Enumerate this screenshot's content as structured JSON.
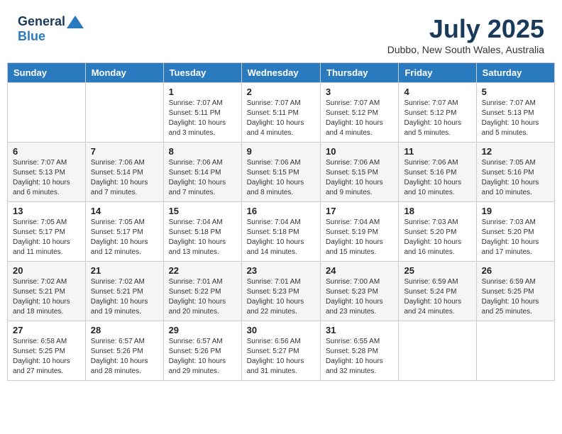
{
  "header": {
    "logo_general": "General",
    "logo_blue": "Blue",
    "month_title": "July 2025",
    "location": "Dubbo, New South Wales, Australia"
  },
  "days_of_week": [
    "Sunday",
    "Monday",
    "Tuesday",
    "Wednesday",
    "Thursday",
    "Friday",
    "Saturday"
  ],
  "weeks": [
    [
      {
        "day": "",
        "info": ""
      },
      {
        "day": "",
        "info": ""
      },
      {
        "day": "1",
        "info": "Sunrise: 7:07 AM\nSunset: 5:11 PM\nDaylight: 10 hours and 3 minutes."
      },
      {
        "day": "2",
        "info": "Sunrise: 7:07 AM\nSunset: 5:11 PM\nDaylight: 10 hours and 4 minutes."
      },
      {
        "day": "3",
        "info": "Sunrise: 7:07 AM\nSunset: 5:12 PM\nDaylight: 10 hours and 4 minutes."
      },
      {
        "day": "4",
        "info": "Sunrise: 7:07 AM\nSunset: 5:12 PM\nDaylight: 10 hours and 5 minutes."
      },
      {
        "day": "5",
        "info": "Sunrise: 7:07 AM\nSunset: 5:13 PM\nDaylight: 10 hours and 5 minutes."
      }
    ],
    [
      {
        "day": "6",
        "info": "Sunrise: 7:07 AM\nSunset: 5:13 PM\nDaylight: 10 hours and 6 minutes."
      },
      {
        "day": "7",
        "info": "Sunrise: 7:06 AM\nSunset: 5:14 PM\nDaylight: 10 hours and 7 minutes."
      },
      {
        "day": "8",
        "info": "Sunrise: 7:06 AM\nSunset: 5:14 PM\nDaylight: 10 hours and 7 minutes."
      },
      {
        "day": "9",
        "info": "Sunrise: 7:06 AM\nSunset: 5:15 PM\nDaylight: 10 hours and 8 minutes."
      },
      {
        "day": "10",
        "info": "Sunrise: 7:06 AM\nSunset: 5:15 PM\nDaylight: 10 hours and 9 minutes."
      },
      {
        "day": "11",
        "info": "Sunrise: 7:06 AM\nSunset: 5:16 PM\nDaylight: 10 hours and 10 minutes."
      },
      {
        "day": "12",
        "info": "Sunrise: 7:05 AM\nSunset: 5:16 PM\nDaylight: 10 hours and 10 minutes."
      }
    ],
    [
      {
        "day": "13",
        "info": "Sunrise: 7:05 AM\nSunset: 5:17 PM\nDaylight: 10 hours and 11 minutes."
      },
      {
        "day": "14",
        "info": "Sunrise: 7:05 AM\nSunset: 5:17 PM\nDaylight: 10 hours and 12 minutes."
      },
      {
        "day": "15",
        "info": "Sunrise: 7:04 AM\nSunset: 5:18 PM\nDaylight: 10 hours and 13 minutes."
      },
      {
        "day": "16",
        "info": "Sunrise: 7:04 AM\nSunset: 5:18 PM\nDaylight: 10 hours and 14 minutes."
      },
      {
        "day": "17",
        "info": "Sunrise: 7:04 AM\nSunset: 5:19 PM\nDaylight: 10 hours and 15 minutes."
      },
      {
        "day": "18",
        "info": "Sunrise: 7:03 AM\nSunset: 5:20 PM\nDaylight: 10 hours and 16 minutes."
      },
      {
        "day": "19",
        "info": "Sunrise: 7:03 AM\nSunset: 5:20 PM\nDaylight: 10 hours and 17 minutes."
      }
    ],
    [
      {
        "day": "20",
        "info": "Sunrise: 7:02 AM\nSunset: 5:21 PM\nDaylight: 10 hours and 18 minutes."
      },
      {
        "day": "21",
        "info": "Sunrise: 7:02 AM\nSunset: 5:21 PM\nDaylight: 10 hours and 19 minutes."
      },
      {
        "day": "22",
        "info": "Sunrise: 7:01 AM\nSunset: 5:22 PM\nDaylight: 10 hours and 20 minutes."
      },
      {
        "day": "23",
        "info": "Sunrise: 7:01 AM\nSunset: 5:23 PM\nDaylight: 10 hours and 22 minutes."
      },
      {
        "day": "24",
        "info": "Sunrise: 7:00 AM\nSunset: 5:23 PM\nDaylight: 10 hours and 23 minutes."
      },
      {
        "day": "25",
        "info": "Sunrise: 6:59 AM\nSunset: 5:24 PM\nDaylight: 10 hours and 24 minutes."
      },
      {
        "day": "26",
        "info": "Sunrise: 6:59 AM\nSunset: 5:25 PM\nDaylight: 10 hours and 25 minutes."
      }
    ],
    [
      {
        "day": "27",
        "info": "Sunrise: 6:58 AM\nSunset: 5:25 PM\nDaylight: 10 hours and 27 minutes."
      },
      {
        "day": "28",
        "info": "Sunrise: 6:57 AM\nSunset: 5:26 PM\nDaylight: 10 hours and 28 minutes."
      },
      {
        "day": "29",
        "info": "Sunrise: 6:57 AM\nSunset: 5:26 PM\nDaylight: 10 hours and 29 minutes."
      },
      {
        "day": "30",
        "info": "Sunrise: 6:56 AM\nSunset: 5:27 PM\nDaylight: 10 hours and 31 minutes."
      },
      {
        "day": "31",
        "info": "Sunrise: 6:55 AM\nSunset: 5:28 PM\nDaylight: 10 hours and 32 minutes."
      },
      {
        "day": "",
        "info": ""
      },
      {
        "day": "",
        "info": ""
      }
    ]
  ]
}
